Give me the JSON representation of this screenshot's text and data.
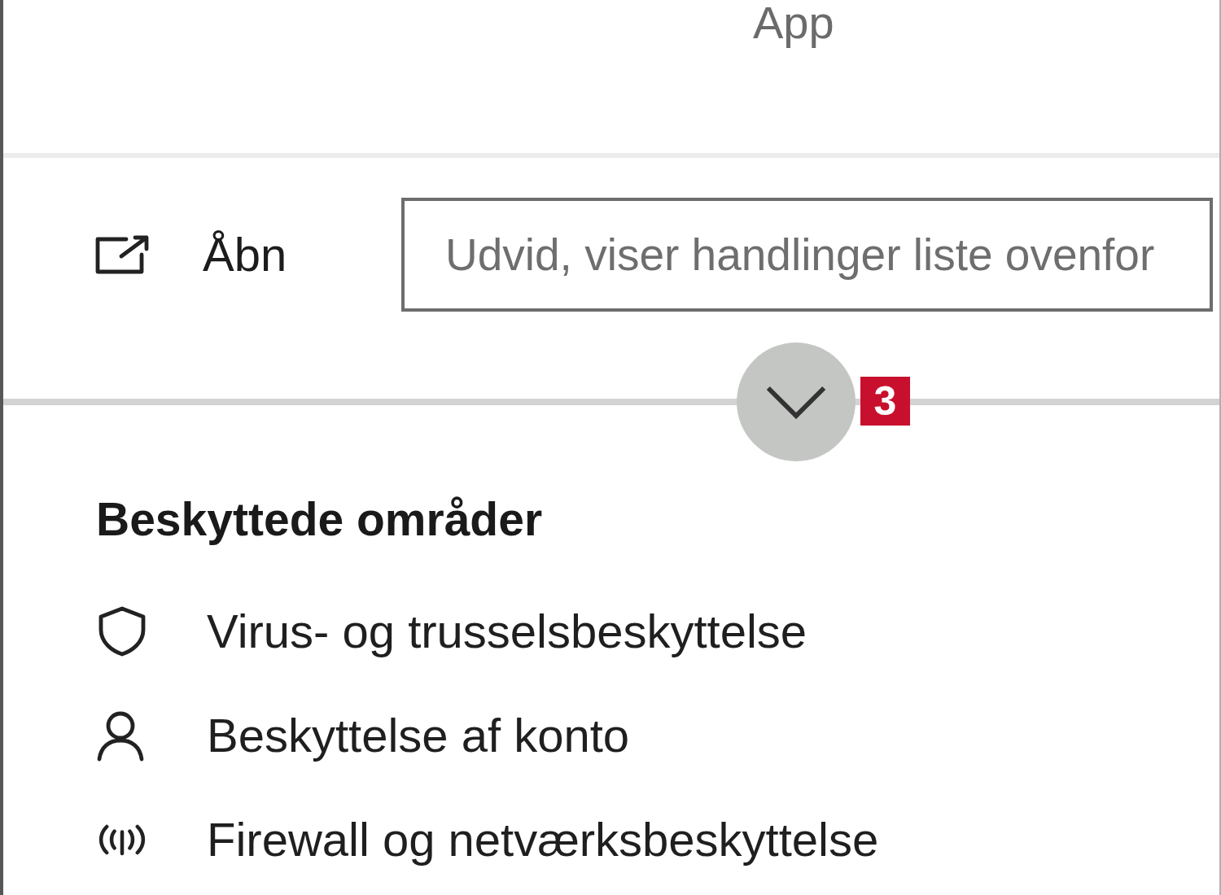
{
  "app_label": "App",
  "actions": [
    {
      "label": "Åbn"
    }
  ],
  "tooltip": {
    "text": "Udvid, viser handlinger liste ovenfor"
  },
  "expand_button": {
    "expanded": false
  },
  "callout_number": "3",
  "protected_areas": {
    "title": "Beskyttede områder",
    "items": [
      {
        "label": "Virus- og trusselsbeskyttelse"
      },
      {
        "label": "Beskyttelse af konto"
      },
      {
        "label": "Firewall og netværksbeskyttelse"
      }
    ]
  }
}
